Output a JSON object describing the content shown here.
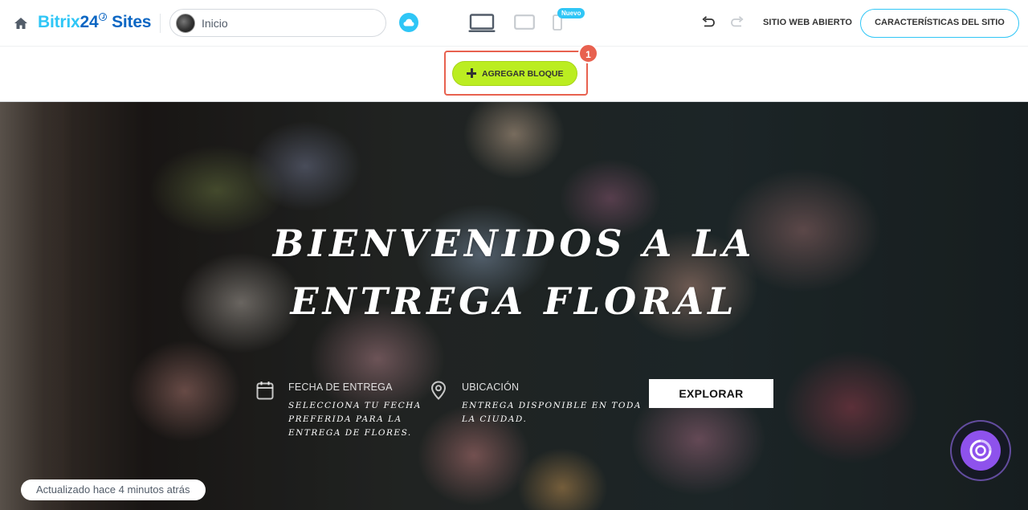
{
  "header": {
    "brand_part1": "Bitrix",
    "brand_part2": "24",
    "brand_part3": " Sites",
    "current_page": "Inicio",
    "new_badge": "Nuevo",
    "open_site": "SITIO WEB ABIERTO",
    "site_features": "CARACTERÍSTICAS DEL SITIO"
  },
  "toolbar": {
    "add_block": "AGREGAR BLOQUE",
    "step_number": "1"
  },
  "hero": {
    "title": "BIENVENIDOS A LA ENTREGA FLORAL",
    "date_heading": "FECHA DE ENTREGA",
    "date_text": "SELECCIONA TU FECHA PREFERIDA PARA LA ENTREGA DE FLORES.",
    "location_heading": "UBICACIÓN",
    "location_text": "ENTREGA DISPONIBLE EN TODA LA CIUDAD.",
    "explore_button": "EXPLORAR"
  },
  "status": {
    "updated": "Actualizado hace 4 minutos atrás"
  },
  "colors": {
    "accent_blue": "#2fc6f6",
    "brand_dark_blue": "#0b66c3",
    "add_block_green": "#bbed21",
    "highlight_red": "#e8614f",
    "assistant_purple": "#8e52ec"
  },
  "icons": {
    "home": "home-icon",
    "cloud": "cloud-icon",
    "desktop": "desktop-device-icon",
    "tablet": "tablet-device-icon",
    "mobile": "mobile-device-icon",
    "undo": "undo-icon",
    "redo": "redo-icon",
    "calendar": "calendar-icon",
    "location": "map-pin-icon",
    "assistant": "copilot-icon"
  }
}
